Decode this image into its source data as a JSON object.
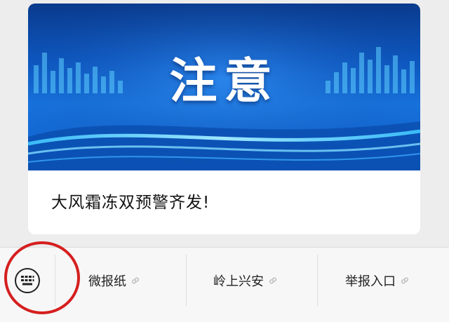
{
  "article_card": {
    "banner_text": "注意",
    "title": "大风霜冻双预警齐发!"
  },
  "menu": {
    "keyboard_icon": "keyboard-icon",
    "items": [
      {
        "label": "微报纸",
        "icon": "link-icon"
      },
      {
        "label": "岭上兴安",
        "icon": "link-icon"
      },
      {
        "label": "举报入口",
        "icon": "link-icon"
      }
    ]
  },
  "colors": {
    "annotation": "#d51f1f",
    "banner_blue": "#0d58c2"
  }
}
